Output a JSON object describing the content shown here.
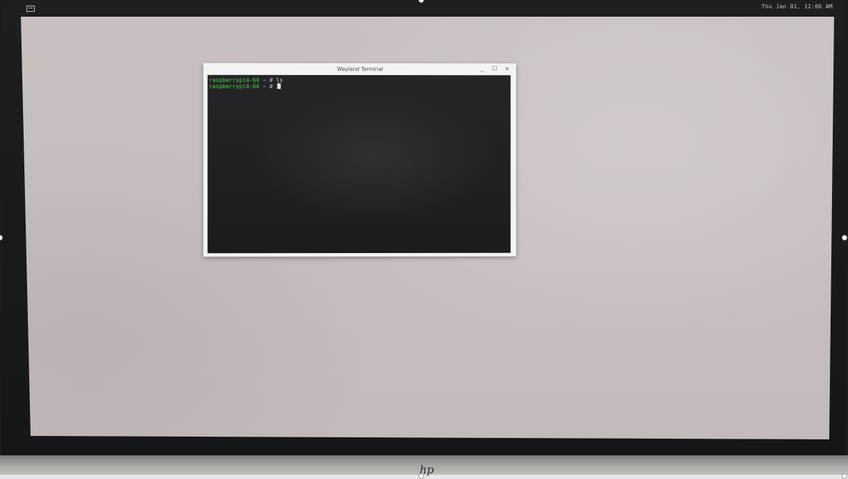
{
  "panel": {
    "clock": "Thu Jan 01, 12:06 AM",
    "menu_icon": "menu-icon"
  },
  "terminal": {
    "title": "Wayland Terminal",
    "controls": {
      "minimize": "_",
      "maximize": "☐",
      "close": "×"
    },
    "lines": [
      {
        "prompt": "raspberrypi4-64",
        "sep": " ~ # ",
        "command": "ls"
      },
      {
        "prompt": "raspberrypi4-64",
        "sep": " ~ # ",
        "command": ""
      }
    ]
  },
  "monitor": {
    "logo": "hp"
  },
  "colors": {
    "prompt": "#4ed34a",
    "terminal_bg": "#1f2022",
    "desktop_bg": "#c6bebd"
  }
}
